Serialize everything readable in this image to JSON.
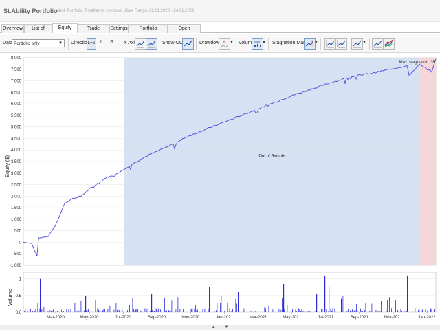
{
  "window": {
    "title": "St.Ability Portfolio",
    "subtitle": "Symbol: Portfolio, Timeframe: unknown, Date Range: 02.01.2020 - 24.01.2022"
  },
  "tabs": [
    {
      "label": "Overview",
      "active": false
    },
    {
      "label": "List of trades",
      "active": false
    },
    {
      "label": "Equity chart",
      "active": true
    },
    {
      "label": "Trade analysis",
      "active": false
    },
    {
      "label": "Settings",
      "active": false
    },
    {
      "label": "Portfolio correlation",
      "active": false
    },
    {
      "label": "Open balances",
      "active": false
    }
  ],
  "toolbar": {
    "data_label": "Data",
    "data_value": "Portfolio only",
    "direction_label": "Direction",
    "direction_options": [
      "L+S",
      "L",
      "S"
    ],
    "xaxis_label": "X Axis",
    "xaxis_btn1": "Trades",
    "xaxis_btn2": "Time",
    "show_oos_label": "Show OOS",
    "drawdown_label": "Drawdown",
    "drawdown_btn": "Off",
    "volume_label": "Volume",
    "volume_btn": "Bars",
    "stagnation_label": "Stagnation Marker",
    "dropdown_arrow": "▼"
  },
  "chart_data": [
    {
      "type": "line",
      "title": "",
      "ylabel": "Equity ($)",
      "xlabel": "",
      "ylim": [
        -1000,
        8000
      ],
      "yticks": [
        "8,000",
        "7,500",
        "7,000",
        "6,500",
        "6,000",
        "5,500",
        "5,000",
        "4,500",
        "4,000",
        "3,500",
        "3,000",
        "2,500",
        "2,000",
        "1,500",
        "1,000",
        "500",
        "0",
        "-500",
        "-1,000"
      ],
      "series": [
        {
          "color": "#4a4adc",
          "x": [
            0.0,
            0.02,
            0.033,
            0.037,
            0.06,
            0.08,
            0.1,
            0.12,
            0.14,
            0.16,
            0.2,
            0.22,
            0.26,
            0.3,
            0.35,
            0.4,
            0.45,
            0.5,
            0.55,
            0.6,
            0.65,
            0.7,
            0.75,
            0.8,
            0.85,
            0.9,
            0.93,
            0.935,
            0.96,
            0.99,
            1.0
          ],
          "y": [
            0,
            -50,
            -600,
            200,
            250,
            800,
            1700,
            1900,
            2000,
            2300,
            2800,
            2900,
            3350,
            3750,
            4150,
            4600,
            4950,
            5300,
            5650,
            6000,
            6350,
            6650,
            6950,
            7200,
            7350,
            7550,
            7650,
            7250,
            7700,
            7400,
            7950
          ]
        }
      ],
      "annotations": [
        {
          "text": "Out of Sample",
          "region": [
            0.245,
            0.96
          ],
          "color": "#d6e2f3"
        },
        {
          "text": "Max. stagnation: 35",
          "region": [
            0.96,
            1.0
          ],
          "color": "#f5d7d9"
        }
      ],
      "grid": true
    },
    {
      "type": "bar",
      "ylabel": "Volume",
      "ylim": [
        0,
        1.2
      ],
      "yticks": [
        "1",
        "0.5",
        "0.0"
      ],
      "xticks": [
        "Mar-2020",
        "May-2020",
        "Jul-2020",
        "Sep-2020",
        "Nov-2020",
        "Jan-2021",
        "Mar-2021",
        "May-2021",
        "Jul-2021",
        "Sep-2021",
        "Nov-2021",
        "Jan-2022"
      ],
      "color": "#2b2bd9",
      "peaks": [
        {
          "x": 0.04,
          "value": 1.0
        },
        {
          "x": 0.15,
          "value": 0.5
        },
        {
          "x": 0.31,
          "value": 0.55
        },
        {
          "x": 0.45,
          "value": 0.75
        },
        {
          "x": 0.52,
          "value": 0.6
        },
        {
          "x": 0.63,
          "value": 0.85
        },
        {
          "x": 0.71,
          "value": 0.55
        },
        {
          "x": 0.73,
          "value": 1.1
        },
        {
          "x": 0.74,
          "value": 0.75
        },
        {
          "x": 0.77,
          "value": 0.4
        },
        {
          "x": 0.93,
          "value": 1.1
        }
      ]
    }
  ]
}
